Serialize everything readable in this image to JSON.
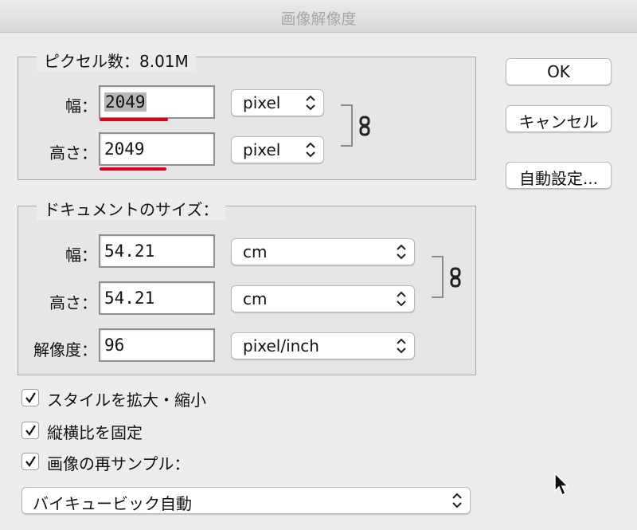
{
  "window": {
    "title": "画像解像度"
  },
  "pixel_dimensions": {
    "legend": "ピクセル数：8.01M",
    "width": {
      "label": "幅：",
      "value": "2049",
      "unit": "pixel"
    },
    "height": {
      "label": "高さ：",
      "value": "2049",
      "unit": "pixel"
    },
    "constrain_link_icon": "chain-link-icon"
  },
  "document_size": {
    "legend": "ドキュメントのサイズ：",
    "width": {
      "label": "幅：",
      "value": "54.21",
      "unit": "cm"
    },
    "height": {
      "label": "高さ：",
      "value": "54.21",
      "unit": "cm"
    },
    "resolution": {
      "label": "解像度：",
      "value": "96",
      "unit": "pixel/inch"
    }
  },
  "buttons": {
    "ok": "OK",
    "cancel": "キャンセル",
    "auto": "自動設定..."
  },
  "options": {
    "scale_styles": {
      "label": "スタイルを拡大・縮小",
      "checked": true
    },
    "constrain_proportions": {
      "label": "縦横比を固定",
      "checked": true
    },
    "resample": {
      "label": "画像の再サンプル：",
      "checked": true
    },
    "resample_method": "バイキュービック自動"
  },
  "colors": {
    "annotation_underline": "#e0001a",
    "dialog_bg": "#ececec"
  }
}
